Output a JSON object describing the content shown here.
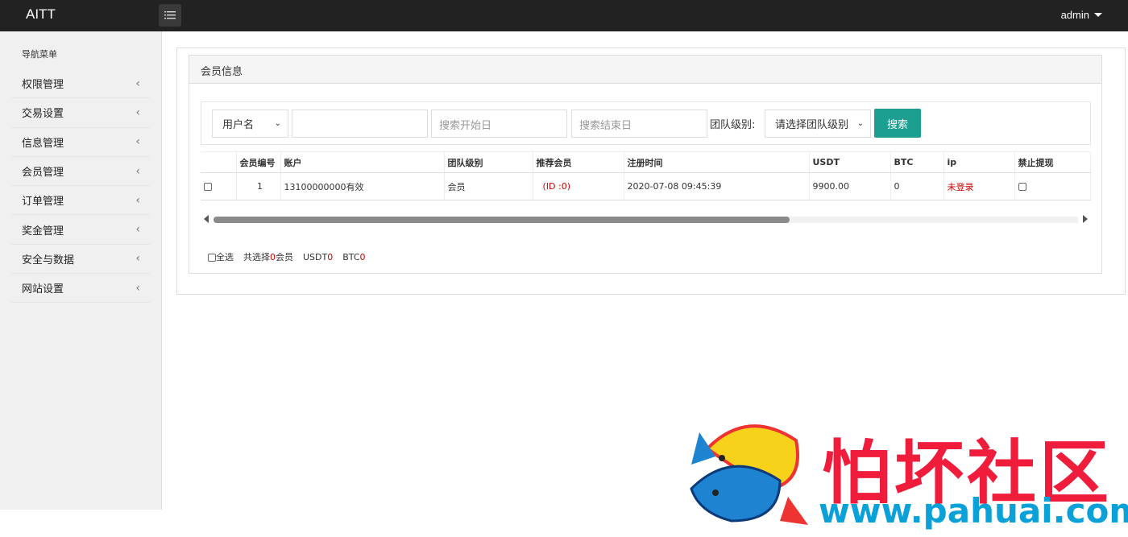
{
  "header": {
    "brand": "AITT",
    "user": "admin"
  },
  "sidebar": {
    "heading": "导航菜单",
    "items": [
      {
        "label": "权限管理"
      },
      {
        "label": "交易设置"
      },
      {
        "label": "信息管理"
      },
      {
        "label": "会员管理"
      },
      {
        "label": "订单管理"
      },
      {
        "label": "奖金管理"
      },
      {
        "label": "安全与数据"
      },
      {
        "label": "网站设置"
      }
    ]
  },
  "panel": {
    "title": "会员信息"
  },
  "search": {
    "field_select": "用户名",
    "keyword_value": "",
    "start_placeholder": "搜索开始日",
    "end_placeholder": "搜索结束日",
    "team_label": "团队级别:",
    "team_select": "请选择团队级别",
    "button": "搜索"
  },
  "table": {
    "columns": [
      "",
      "会员编号",
      "账户",
      "团队级别",
      "推荐会员",
      "注册时间",
      "USDT",
      "BTC",
      "ip",
      "禁止提现"
    ],
    "rows": [
      {
        "id": "1",
        "account": "13100000000有效",
        "team": "会员",
        "referrer": "(ID :0)",
        "registered": "2020-07-08 09:45:39",
        "usdt": "9900.00",
        "btc": "0",
        "ip": "未登录"
      }
    ]
  },
  "footer": {
    "select_all": "全选",
    "selected_prefix": "共选择",
    "selected_count": "0",
    "selected_suffix": "会员",
    "usdt_label": "USDT",
    "usdt_value": "0",
    "btc_label": "BTC",
    "btc_value": "0"
  },
  "watermark": {
    "text": "怕坏社区",
    "url": "www.pahuai.com"
  },
  "colors": {
    "topbar": "#222222",
    "accent": "#1c9f90",
    "red": "#cc0000",
    "watermark_red": "#ef1c3c",
    "watermark_blue": "#0aa0d8"
  }
}
